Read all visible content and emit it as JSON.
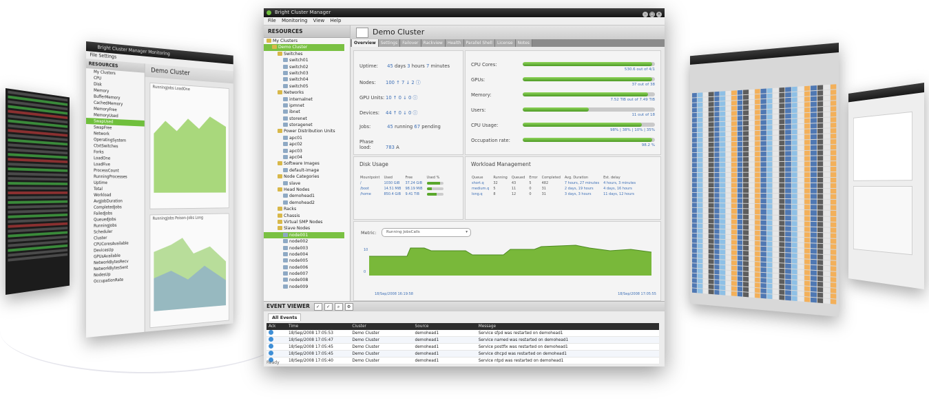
{
  "app": {
    "title": "Bright Cluster Manager",
    "menu": [
      "File",
      "Monitoring",
      "View",
      "Help"
    ]
  },
  "resources": {
    "header": "RESOURCES",
    "tree": [
      {
        "label": "My Clusters",
        "depth": 0,
        "folder": true
      },
      {
        "label": "Demo Cluster",
        "depth": 1,
        "folder": true,
        "selected": true
      },
      {
        "label": "Switches",
        "depth": 2,
        "folder": true
      },
      {
        "label": "switch01",
        "depth": 3
      },
      {
        "label": "switch02",
        "depth": 3
      },
      {
        "label": "switch03",
        "depth": 3
      },
      {
        "label": "switch04",
        "depth": 3
      },
      {
        "label": "switch05",
        "depth": 3
      },
      {
        "label": "Networks",
        "depth": 2,
        "folder": true
      },
      {
        "label": "internalnet",
        "depth": 3
      },
      {
        "label": "ipmnet",
        "depth": 3
      },
      {
        "label": "ibnet",
        "depth": 3
      },
      {
        "label": "storenet",
        "depth": 3
      },
      {
        "label": "storagenet",
        "depth": 3
      },
      {
        "label": "Power Distribution Units",
        "depth": 2,
        "folder": true
      },
      {
        "label": "apc01",
        "depth": 3
      },
      {
        "label": "apc02",
        "depth": 3
      },
      {
        "label": "apc03",
        "depth": 3
      },
      {
        "label": "apc04",
        "depth": 3
      },
      {
        "label": "Software Images",
        "depth": 2,
        "folder": true
      },
      {
        "label": "default-image",
        "depth": 3
      },
      {
        "label": "Node Categories",
        "depth": 2,
        "folder": true
      },
      {
        "label": "slave",
        "depth": 3
      },
      {
        "label": "Head Nodes",
        "depth": 2,
        "folder": true
      },
      {
        "label": "demohead1",
        "depth": 3
      },
      {
        "label": "demohead2",
        "depth": 3
      },
      {
        "label": "Racks",
        "depth": 2,
        "folder": true
      },
      {
        "label": "Chassis",
        "depth": 2,
        "folder": true
      },
      {
        "label": "Virtual SMP Nodes",
        "depth": 2,
        "folder": true
      },
      {
        "label": "Slave Nodes",
        "depth": 2,
        "folder": true
      },
      {
        "label": "node001",
        "depth": 3,
        "selected": true
      },
      {
        "label": "node002",
        "depth": 3
      },
      {
        "label": "node003",
        "depth": 3
      },
      {
        "label": "node004",
        "depth": 3
      },
      {
        "label": "node005",
        "depth": 3
      },
      {
        "label": "node006",
        "depth": 3
      },
      {
        "label": "node007",
        "depth": 3
      },
      {
        "label": "node008",
        "depth": 3
      },
      {
        "label": "node009",
        "depth": 3
      }
    ]
  },
  "cluster": {
    "name": "Demo Cluster",
    "tabs": [
      "Overview",
      "Settings",
      "Failover",
      "Rackview",
      "Health",
      "Parallel Shell",
      "License",
      "Notes"
    ],
    "overview": {
      "uptime": {
        "label": "Uptime:",
        "v1": "45",
        "u1": "days",
        "v2": "3",
        "u2": "hours",
        "v3": "7",
        "u3": "minutes"
      },
      "nodes": {
        "label": "Nodes:",
        "value": "100 ↑ 7 ↓ 2 ⓘ"
      },
      "gpu": {
        "label": "GPU Units:",
        "value": "10 ↑ 0 ↓ 0 ⓘ"
      },
      "devices": {
        "label": "Devices:",
        "value": "44 ↑ 0 ↓ 0 ⓘ"
      },
      "jobs": {
        "label": "Jobs:",
        "v1": "45",
        "u1": "running",
        "v2": "67",
        "u2": "pending"
      },
      "phase": {
        "label": "Phase load:",
        "value": "783",
        "unit": "A"
      }
    },
    "gauges": [
      {
        "label": "CPU Cores:",
        "fill": 0.98,
        "value": "530.6 out of 4/1"
      },
      {
        "label": "GPUs:",
        "fill": 0.98,
        "value": "37 out of 38"
      },
      {
        "label": "Memory:",
        "fill": 0.95,
        "value": "7.52 TiB out of 7.49 TiB"
      },
      {
        "label": "Users:",
        "fill": 0.5,
        "value": "11 out of 18"
      },
      {
        "label": "CPU Usage:",
        "fill": 0.9,
        "value": "98% | 38% | 10% | 35%"
      },
      {
        "label": "Occupation rate:",
        "fill": 0.98,
        "value": "98.2 %"
      }
    ],
    "disk": {
      "title": "Disk Usage",
      "headers": [
        "Mountpoint",
        "Used",
        "Free",
        "Used %"
      ],
      "rows": [
        {
          "mount": "/",
          "used": "1030 GiB",
          "free": "37.24 GiB",
          "pct": 0.8
        },
        {
          "mount": "/boot",
          "used": "14.51 MiB",
          "free": "98.19 MiB",
          "pct": 0.3
        },
        {
          "mount": "/home",
          "used": "850.4 GiB",
          "free": "9.41 TiB",
          "pct": 0.6
        }
      ]
    },
    "workload": {
      "title": "Workload Management",
      "headers": [
        "Queue",
        "Running",
        "Queued",
        "Error",
        "Completed",
        "Avg. Duration",
        "Est. delay"
      ],
      "rows": [
        [
          "short.q",
          "32",
          "43",
          "5",
          "482",
          "7 hours, 27 minutes",
          "4 hours, 3 minutes"
        ],
        [
          "medium.q",
          "5",
          "11",
          "0",
          "31",
          "2 days, 19 hours",
          "4 days, 16 hours"
        ],
        [
          "long.q",
          "8",
          "12",
          "0",
          "31",
          "3 days, 3 hours",
          "11 days, 12 hours"
        ]
      ]
    },
    "metric": {
      "label": "Metric:",
      "selected": "Running JobsCalls",
      "y_top": "10",
      "y_bottom": "0",
      "x_start": "18/Sep/2008 16:19:58",
      "x_end": "18/Sep/2008 17:05:55"
    }
  },
  "event_viewer": {
    "title": "EVENT VIEWER",
    "tab": "All Events",
    "columns": [
      "Ack",
      "Time",
      "Cluster",
      "Source",
      "Message"
    ],
    "rows": [
      [
        "18/Sep/2008 17:05:53",
        "Demo Cluster",
        "demohead1",
        "Service sfpd was restarted on demohead1"
      ],
      [
        "18/Sep/2008 17:05:47",
        "Demo Cluster",
        "demohead1",
        "Service named was restarted on demohead1"
      ],
      [
        "18/Sep/2008 17:05:45",
        "Demo Cluster",
        "demohead1",
        "Service postfix was restarted on demohead1"
      ],
      [
        "18/Sep/2008 17:05:45",
        "Demo Cluster",
        "demohead1",
        "Service dhcpd was restarted on demohead1"
      ],
      [
        "18/Sep/2008 17:05:40",
        "Demo Cluster",
        "demohead1",
        "Service ntpd was restarted on demohead1"
      ]
    ],
    "status": "Ready"
  },
  "left_window": {
    "title": "Bright Cluster Manager Monitoring",
    "header": "RESOURCES",
    "panel_title": "Demo Cluster",
    "items": [
      "My Clusters",
      "CPU",
      "Disk",
      "Memory",
      "BufferMemory",
      "CachedMemory",
      "MemoryFree",
      "MemoryUsed",
      "SwapUsed",
      "SwapFree",
      "Network",
      "OperatingSystem",
      "CtxtSwitches",
      "Forks",
      "LoadOne",
      "LoadFive",
      "ProcessCount",
      "RunningProcesses",
      "Uptime",
      "Total",
      "Workload",
      "AvgJobDuration",
      "CompletedJobs",
      "FailedJobs",
      "QueuedJobs",
      "RunningJobs",
      "Scheduler",
      "Cluster",
      "CPUCoresAvailable",
      "DevicesUp",
      "GPUsAvailable",
      "NetworkBytesRecv",
      "NetworkBytesSent",
      "NodesUp",
      "OccupationRate"
    ],
    "graph1": "RunningJobs LoadOne",
    "graph2": "RunningJobs Poison-Jobs Long"
  }
}
